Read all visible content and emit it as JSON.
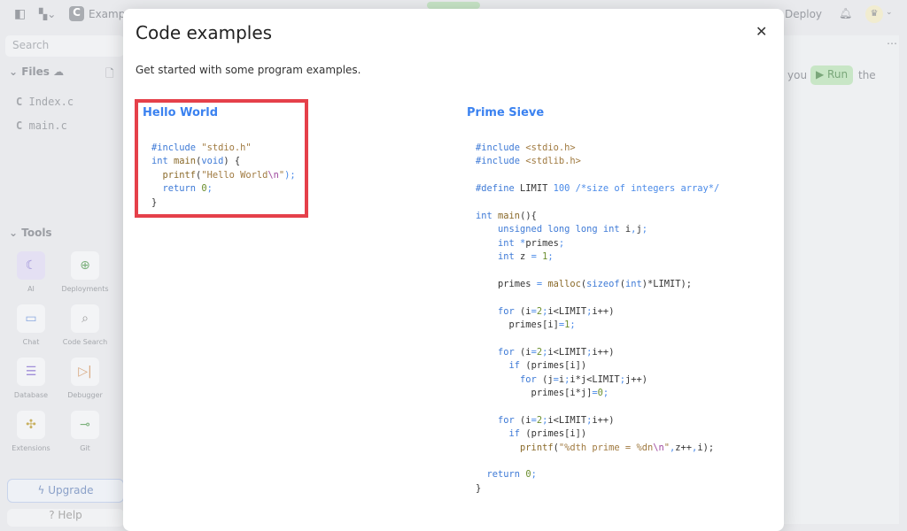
{
  "topbar": {
    "project": "Examp",
    "deploy": "Deploy"
  },
  "sidebar": {
    "search_placeholder": "Search",
    "files_label": "Files",
    "files": [
      "Index.c",
      "main.c"
    ],
    "tools_label": "Tools",
    "tools": [
      {
        "label": "AI",
        "icon": "ai-icon"
      },
      {
        "label": "Deployments",
        "icon": "globe-icon"
      },
      {
        "label": "Chat",
        "icon": "chat-icon"
      },
      {
        "label": "Code Search",
        "icon": "search-icon"
      },
      {
        "label": "Database",
        "icon": "database-icon"
      },
      {
        "label": "Debugger",
        "icon": "debugger-icon"
      },
      {
        "label": "Extensions",
        "icon": "puzzle-icon"
      },
      {
        "label": "Git",
        "icon": "git-icon"
      }
    ],
    "upgrade": "Upgrade",
    "help": "Help"
  },
  "right": {
    "before": "you",
    "run": "Run",
    "after": "the"
  },
  "modal": {
    "title": "Code examples",
    "subtitle": "Get started with some program examples.",
    "examples": [
      {
        "title": "Hello World",
        "lines": [
          [
            [
              "#include ",
              "k"
            ],
            [
              "\"stdio.h\"",
              "s"
            ]
          ],
          [
            [
              "int ",
              "k"
            ],
            [
              "main",
              "f"
            ],
            [
              "(",
              "o"
            ],
            [
              "void",
              "k"
            ],
            [
              ") {",
              "o"
            ]
          ],
          [
            [
              "  printf",
              "f"
            ],
            [
              "(",
              "o"
            ],
            [
              "\"Hello World",
              "s"
            ],
            [
              "\\n",
              "e"
            ],
            [
              "\"",
              "s"
            ],
            [
              ");",
              "p"
            ]
          ],
          [
            [
              "  return ",
              "k"
            ],
            [
              "0",
              "n"
            ],
            [
              ";",
              "p"
            ]
          ],
          [
            [
              "}",
              "o"
            ]
          ]
        ]
      },
      {
        "title": "Prime Sieve",
        "lines": [
          [
            [
              "#include ",
              "k"
            ],
            [
              "<stdio.h>",
              "s"
            ]
          ],
          [
            [
              "#include ",
              "k"
            ],
            [
              "<stdlib.h>",
              "s"
            ]
          ],
          [],
          [
            [
              "#define ",
              "k"
            ],
            [
              "LIMIT ",
              "o"
            ],
            [
              "100 /*size of integers array*/",
              "p"
            ]
          ],
          [],
          [
            [
              "int ",
              "k"
            ],
            [
              "main",
              "f"
            ],
            [
              "(){",
              "o"
            ]
          ],
          [
            [
              "    unsigned long long int ",
              "k"
            ],
            [
              "i",
              "o"
            ],
            [
              ",",
              "p"
            ],
            [
              "j",
              "o"
            ],
            [
              ";",
              "p"
            ]
          ],
          [
            [
              "    int ",
              "k"
            ],
            [
              "*",
              "p"
            ],
            [
              "primes",
              "o"
            ],
            [
              ";",
              "p"
            ]
          ],
          [
            [
              "    int ",
              "k"
            ],
            [
              "z ",
              "o"
            ],
            [
              "= ",
              "p"
            ],
            [
              "1",
              "n"
            ],
            [
              ";",
              "p"
            ]
          ],
          [],
          [
            [
              "    primes ",
              "o"
            ],
            [
              "= ",
              "p"
            ],
            [
              "malloc",
              "f"
            ],
            [
              "(",
              "o"
            ],
            [
              "sizeof",
              "k"
            ],
            [
              "(",
              "o"
            ],
            [
              "int",
              "k"
            ],
            [
              ")*LIMIT);",
              "o"
            ]
          ],
          [],
          [
            [
              "    for ",
              "k"
            ],
            [
              "(i",
              "o"
            ],
            [
              "=",
              "p"
            ],
            [
              "2",
              "n"
            ],
            [
              ";",
              "p"
            ],
            [
              "i<LIMIT",
              "o"
            ],
            [
              ";",
              "p"
            ],
            [
              "i++)",
              "o"
            ]
          ],
          [
            [
              "      primes[i]",
              "o"
            ],
            [
              "=",
              "p"
            ],
            [
              "1",
              "n"
            ],
            [
              ";",
              "p"
            ]
          ],
          [],
          [
            [
              "    for ",
              "k"
            ],
            [
              "(i",
              "o"
            ],
            [
              "=",
              "p"
            ],
            [
              "2",
              "n"
            ],
            [
              ";",
              "p"
            ],
            [
              "i<LIMIT",
              "o"
            ],
            [
              ";",
              "p"
            ],
            [
              "i++)",
              "o"
            ]
          ],
          [
            [
              "      if ",
              "k"
            ],
            [
              "(primes[i])",
              "o"
            ]
          ],
          [
            [
              "        for ",
              "k"
            ],
            [
              "(j",
              "o"
            ],
            [
              "=",
              "p"
            ],
            [
              "i",
              "o"
            ],
            [
              ";",
              "p"
            ],
            [
              "i*j<LIMIT",
              "o"
            ],
            [
              ";",
              "p"
            ],
            [
              "j++)",
              "o"
            ]
          ],
          [
            [
              "          primes[i*j]",
              "o"
            ],
            [
              "=",
              "p"
            ],
            [
              "0",
              "n"
            ],
            [
              ";",
              "p"
            ]
          ],
          [],
          [
            [
              "    for ",
              "k"
            ],
            [
              "(i",
              "o"
            ],
            [
              "=",
              "p"
            ],
            [
              "2",
              "n"
            ],
            [
              ";",
              "p"
            ],
            [
              "i<LIMIT",
              "o"
            ],
            [
              ";",
              "p"
            ],
            [
              "i++)",
              "o"
            ]
          ],
          [
            [
              "      if ",
              "k"
            ],
            [
              "(primes[i])",
              "o"
            ]
          ],
          [
            [
              "        printf",
              "f"
            ],
            [
              "(",
              "o"
            ],
            [
              "\"%dth prime = %dn",
              "s"
            ],
            [
              "\\n",
              "e"
            ],
            [
              "\"",
              "s"
            ],
            [
              ",",
              "p"
            ],
            [
              "z++",
              "o"
            ],
            [
              ",",
              "p"
            ],
            [
              "i);",
              "o"
            ]
          ],
          [],
          [
            [
              "  return ",
              "k"
            ],
            [
              "0",
              "n"
            ],
            [
              ";",
              "p"
            ]
          ],
          [
            [
              "}",
              "o"
            ]
          ]
        ]
      }
    ],
    "highlight_color": "#e5404a"
  }
}
